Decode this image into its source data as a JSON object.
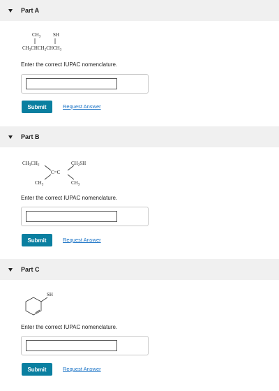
{
  "parts": [
    {
      "title": "Part A",
      "instruction": "Enter the correct IUPAC nomenclature.",
      "input_value": "",
      "submit_label": "Submit",
      "request_label": "Request Answer",
      "structure": {
        "top_labels": [
          "CH3",
          "SH"
        ],
        "main_chain": "CH3CHCH2CHCH3"
      }
    },
    {
      "title": "Part B",
      "instruction": "Enter the correct IUPAC nomenclature.",
      "input_value": "",
      "submit_label": "Submit",
      "request_label": "Request Answer",
      "structure": {
        "upper_left": "CH3CH2",
        "upper_right": "CH2SH",
        "lower_left": "CH3",
        "lower_right": "CH3",
        "double_bond": "C=C"
      }
    },
    {
      "title": "Part C",
      "instruction": "Enter the correct IUPAC nomenclature.",
      "input_value": "",
      "submit_label": "Submit",
      "request_label": "Request Answer",
      "structure": {
        "substituent": "SH"
      }
    }
  ],
  "colors": {
    "header_bg": "#f0f0f0",
    "submit_bg": "#0a7fa0",
    "link": "#1a73c6"
  }
}
